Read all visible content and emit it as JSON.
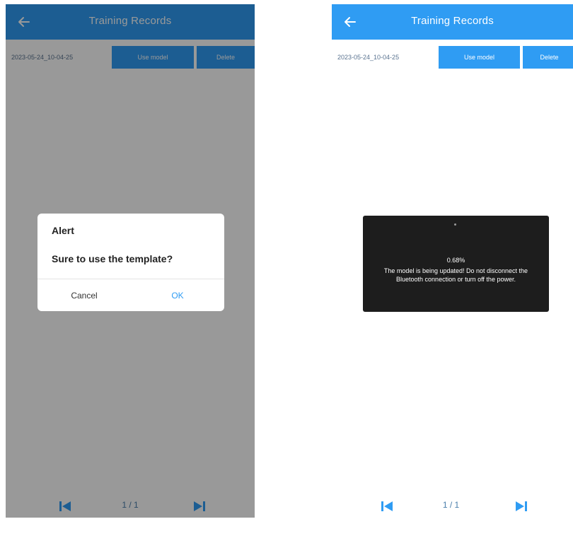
{
  "left_screen": {
    "header": {
      "title": "Training Records"
    },
    "record": {
      "date": "2023-05-24_10-04-25",
      "use_model_label": "Use model",
      "delete_label": "Delete"
    },
    "pager": {
      "text": "1 / 1"
    },
    "dialog": {
      "title": "Alert",
      "message": "Sure to use the template?",
      "cancel_label": "Cancel",
      "ok_label": "OK"
    }
  },
  "right_screen": {
    "header": {
      "title": "Training Records"
    },
    "record": {
      "date": "2023-05-24_10-04-25",
      "use_model_label": "Use model",
      "delete_label": "Delete"
    },
    "pager": {
      "text": "1 / 1"
    },
    "toast": {
      "progress_text": "0.68%",
      "message": "The model is being updated! Do not disconnect the Bluetooth connection or turn off the power."
    }
  },
  "colors": {
    "header_blue": "#2f9cf3",
    "overlay": "rgba(0,0,0,0.40)",
    "toast_bg": "#1d1d1d",
    "ok_text": "#2f9cf3"
  },
  "icons": {
    "back": "arrow-left-icon",
    "first_page": "skip-first-icon",
    "last_page": "skip-last-icon"
  }
}
